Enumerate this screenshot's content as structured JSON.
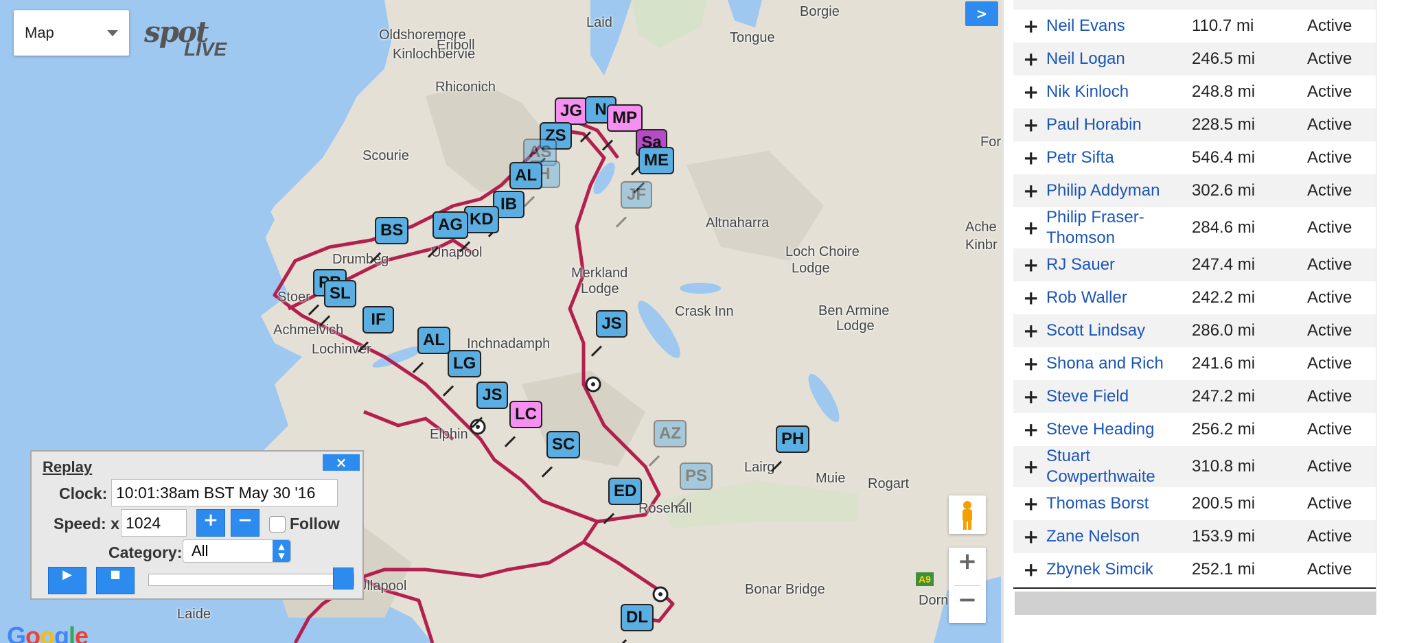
{
  "map_controls": {
    "map_type": "Map",
    "collapse_panel": ">",
    "zoom_in": "+",
    "zoom_out": "−",
    "logo_text_1": "spot",
    "logo_text_2": "LIVE",
    "google_logo": "Google",
    "road_shield": "A9"
  },
  "places": [
    "Borgie",
    "Laid",
    "Oldshoremore",
    "Eriboll",
    "Tongue",
    "Kinlochbervie",
    "Rhiconich",
    "Scourie",
    "Drumbeg",
    "Unapool",
    "Altnaharra",
    "Loch Choire",
    "Lodge",
    "Merkland",
    "Lodge",
    "Stoer",
    "Achmelvich",
    "Lochinver",
    "Crask Inn",
    "Ben Armine",
    "Lodge",
    "Elphin",
    "Lairg",
    "Muie",
    "Rogart",
    "Rosehall",
    "Ullapool",
    "Laide",
    "Bonar Bridge",
    "Dorn",
    "Ache",
    "Kinbr",
    "For",
    "Inchnadamph"
  ],
  "markers": [
    "JG",
    "N",
    "MP",
    "ZS",
    "AS",
    "Sa",
    "ME",
    "AL",
    "H",
    "JF",
    "IB",
    "KD",
    "AG",
    "BS",
    "PB",
    "SL",
    "IF",
    "AL",
    "LG",
    "JS",
    "JS",
    "LC",
    "SC",
    "AZ",
    "PH",
    "PS",
    "ED",
    "DL"
  ],
  "replay": {
    "title": "Replay",
    "close": "×",
    "clock_label": "Clock:",
    "clock_value": "10:01:38am BST May 30 '16",
    "speed_label": "Speed: x",
    "speed_value": "1024",
    "speed_plus": "+",
    "speed_minus": "−",
    "follow_label": "Follow",
    "category_label": "Category:",
    "category_value": "All",
    "play": "▶",
    "stop": "■",
    "progress": 1.0
  },
  "riders": [
    {
      "name": "Neil Evans",
      "distance": "110.7 mi",
      "status": "Active"
    },
    {
      "name": "Neil Logan",
      "distance": "246.5 mi",
      "status": "Active"
    },
    {
      "name": "Nik Kinloch",
      "distance": "248.8 mi",
      "status": "Active"
    },
    {
      "name": "Paul Horabin",
      "distance": "228.5 mi",
      "status": "Active"
    },
    {
      "name": "Petr Sifta",
      "distance": "546.4 mi",
      "status": "Active"
    },
    {
      "name": "Philip Addyman",
      "distance": "302.6 mi",
      "status": "Active"
    },
    {
      "name": "Philip Fraser-Thomson",
      "distance": "284.6 mi",
      "status": "Active"
    },
    {
      "name": "RJ Sauer",
      "distance": "247.4 mi",
      "status": "Active"
    },
    {
      "name": "Rob Waller",
      "distance": "242.2 mi",
      "status": "Active"
    },
    {
      "name": "Scott Lindsay",
      "distance": "286.0 mi",
      "status": "Active"
    },
    {
      "name": "Shona and Rich",
      "distance": "241.6 mi",
      "status": "Active"
    },
    {
      "name": "Steve Field",
      "distance": "247.2 mi",
      "status": "Active"
    },
    {
      "name": "Steve Heading",
      "distance": "256.2 mi",
      "status": "Active"
    },
    {
      "name": "Stuart Cowperthwaite",
      "distance": "310.8 mi",
      "status": "Active"
    },
    {
      "name": "Thomas Borst",
      "distance": "200.5 mi",
      "status": "Active"
    },
    {
      "name": "Zane Nelson",
      "distance": "153.9 mi",
      "status": "Active"
    },
    {
      "name": "Zbynek Simcik",
      "distance": "252.1 mi",
      "status": "Active"
    }
  ]
}
